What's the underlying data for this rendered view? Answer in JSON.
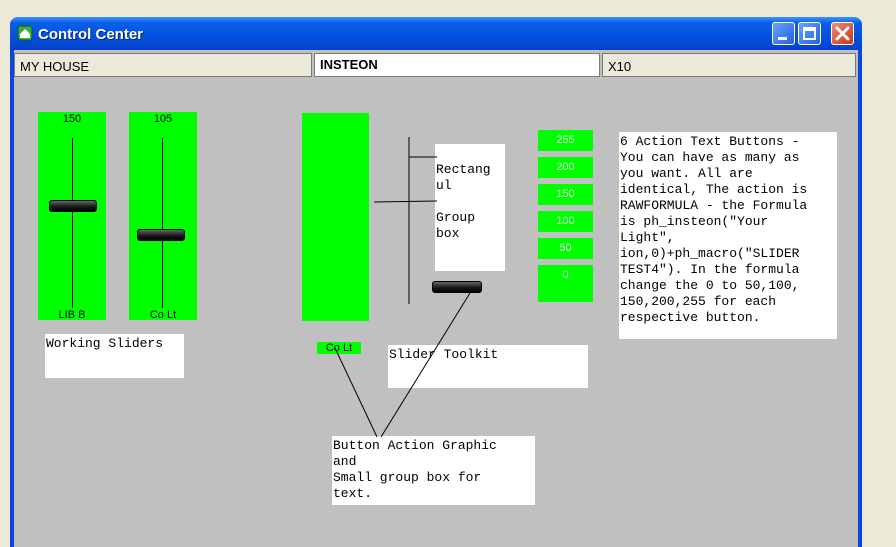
{
  "window": {
    "title": "Control Center"
  },
  "tabs": [
    {
      "label": "MY HOUSE"
    },
    {
      "label": "INSTEON"
    },
    {
      "label": "X10"
    }
  ],
  "sliders": [
    {
      "value_label": "150",
      "name_label": "LIB B",
      "level": 150,
      "max": 255
    },
    {
      "value_label": "105",
      "name_label": "Co Lt",
      "level": 105,
      "max": 255
    }
  ],
  "toolkit": {
    "small_label": "Co Lt",
    "rect_label": "Rectang\nul",
    "group_label": "Group\nbox"
  },
  "action_buttons": [
    "255",
    "200",
    "150",
    "100",
    "50",
    "0"
  ],
  "notes": {
    "working_sliders": "Working Sliders",
    "slider_toolkit": "Slider Toolkit",
    "button_action": "Button Action Graphic\nand\nSmall group box for\ntext.",
    "action_text": "6 Action Text Buttons -\nYou can have as many as\nyou want.  All are\nidentical, The action is\nRAWFORMULA - the Formula\nis ph_insteon(\"Your\nLight\",\nion,0)+ph_macro(\"SLIDER\nTEST4\"). In the formula\nchange the 0 to 50,100,\n150,200,255 for each\nrespective button."
  },
  "colors": {
    "slider_green": "#00ff00",
    "client_bg": "#c0c0c0",
    "titlebar": "#0550de"
  }
}
